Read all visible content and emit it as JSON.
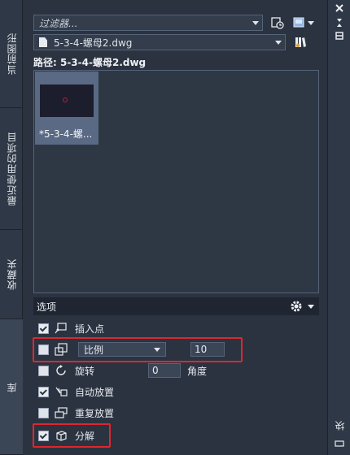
{
  "left_tabs": [
    "当前图形",
    "最近使用的项目",
    "收藏夹",
    "库"
  ],
  "right_strip": {
    "bottom_label": "块"
  },
  "filter": {
    "placeholder": "过滤器..."
  },
  "file_select": {
    "value": "5-3-4-螺母2.dwg"
  },
  "path_label": "路径: 5-3-4-螺母2.dwg",
  "thumbnails": [
    {
      "label": "*5-3-4-螺..."
    }
  ],
  "options": {
    "title": "选项",
    "insertion_point": {
      "label": "插入点",
      "checked": true
    },
    "scale": {
      "checked": false,
      "mode": "比例",
      "value": "10"
    },
    "rotation": {
      "label": "旋转",
      "checked": false,
      "value": "0",
      "unit": "角度"
    },
    "auto_place": {
      "label": "自动放置",
      "checked": true
    },
    "repeat_place": {
      "label": "重复放置",
      "checked": false
    },
    "explode": {
      "label": "分解",
      "checked": true
    }
  },
  "colors": {
    "panel_bg": "#2b3340",
    "highlight": "#e0262e",
    "thumb_selected": "#5a6984"
  }
}
